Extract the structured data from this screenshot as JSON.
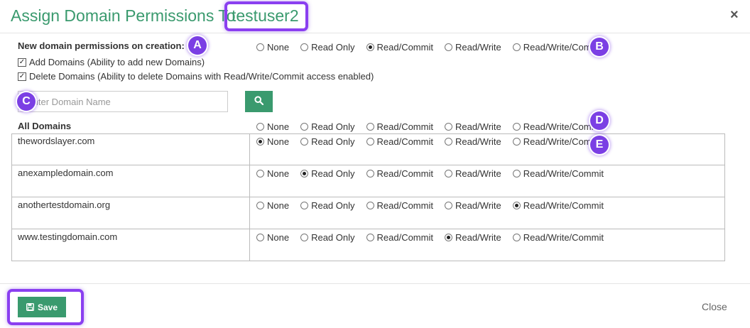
{
  "modal": {
    "title_prefix": "Assign Domain Permissions To ",
    "title_user": "testuser2",
    "close_icon": "×"
  },
  "creation": {
    "label": "New domain permissions on creation:",
    "add_domains_label": "Add Domains (Ability to add new Domains)",
    "add_domains_checked": true,
    "delete_domains_label": "Delete Domains (Ability to delete Domains with Read/Write/Commit access enabled)",
    "delete_domains_checked": true,
    "selected": "Read/Commit"
  },
  "permission_options": [
    "None",
    "Read Only",
    "Read/Commit",
    "Read/Write",
    "Read/Write/Commit"
  ],
  "search": {
    "placeholder": "Enter Domain Name",
    "icon": "search-icon"
  },
  "all_domains": {
    "label": "All Domains",
    "selected": ""
  },
  "domains": [
    {
      "name": "thewordslayer.com",
      "permission": "None"
    },
    {
      "name": "anexampledomain.com",
      "permission": "Read Only"
    },
    {
      "name": "anothertestdomain.org",
      "permission": "Read/Write/Commit"
    },
    {
      "name": "www.testingdomain.com",
      "permission": "Read/Write"
    }
  ],
  "footer": {
    "save_label": "Save",
    "save_icon": "floppy-disk-icon",
    "close_label": "Close"
  },
  "callouts": {
    "a": "A",
    "b": "B",
    "c": "C",
    "d": "D",
    "e": "E"
  },
  "colors": {
    "accent_green": "#3a9a6e",
    "callout_purple": "#7b3fe4"
  }
}
